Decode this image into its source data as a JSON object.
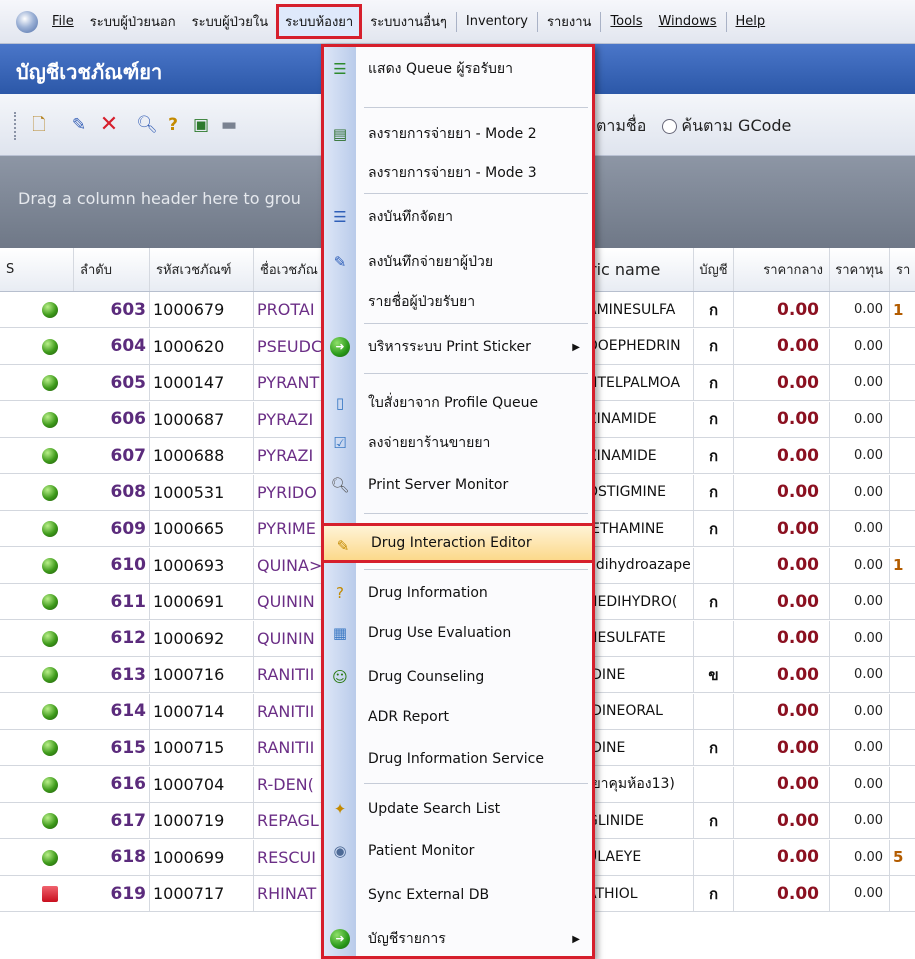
{
  "menubar": {
    "items": [
      {
        "label": "File",
        "underline": true
      },
      {
        "label": "ระบบผู้ป่วยนอก"
      },
      {
        "label": "ระบบผู้ป่วยใน"
      },
      {
        "label": "ระบบห้องยา",
        "active": true
      },
      {
        "label": "ระบบงานอื่นๆ"
      },
      {
        "label": "Inventory"
      },
      {
        "label": "รายงาน"
      },
      {
        "label": "Tools",
        "underline": true
      },
      {
        "label": "Windows",
        "underline": true
      },
      {
        "label": "Help",
        "underline": true
      }
    ]
  },
  "window": {
    "title": "บัญชีเวชภัณฑ์ยา"
  },
  "toolbar": {
    "search_option_name": "ตามชื่อ",
    "search_option_gcode": "ค้นตาม GCode"
  },
  "grid": {
    "group_hint": "Drag a column header here to grou",
    "columns": {
      "s": "S",
      "seq": "ลำดับ",
      "code": "รหัสเวชภัณฑ์",
      "name": "ชื่อเวชภัณ",
      "generic": "ric name",
      "account": "บัญชี",
      "mid_price": "ราคากลาง",
      "cost": "ราคาทุน",
      "extra": "รา"
    },
    "rows": [
      {
        "seq": "603",
        "code": "1000679",
        "name": "PROTAI",
        "generic": "AMINESULFA",
        "account": "ก",
        "mid": "0.00",
        "cost": "0.00",
        "extra": "1",
        "status": "green"
      },
      {
        "seq": "604",
        "code": "1000620",
        "name": "PSEUDC",
        "generic": "DOEPHEDRIN",
        "account": "ก",
        "mid": "0.00",
        "cost": "0.00",
        "extra": "",
        "status": "green"
      },
      {
        "seq": "605",
        "code": "1000147",
        "name": "PYRANT",
        "generic": "NTELPALMOA",
        "account": "ก",
        "mid": "0.00",
        "cost": "0.00",
        "extra": "",
        "status": "green"
      },
      {
        "seq": "606",
        "code": "1000687",
        "name": "PYRAZI",
        "generic": "ZINAMIDE",
        "account": "ก",
        "mid": "0.00",
        "cost": "0.00",
        "extra": "",
        "status": "green"
      },
      {
        "seq": "607",
        "code": "1000688",
        "name": "PYRAZI",
        "generic": "ZINAMIDE",
        "account": "ก",
        "mid": "0.00",
        "cost": "0.00",
        "extra": "",
        "status": "green"
      },
      {
        "seq": "608",
        "code": "1000531",
        "name": "PYRIDO",
        "generic": "OSTIGMINE",
        "account": "ก",
        "mid": "0.00",
        "cost": "0.00",
        "extra": "",
        "status": "green"
      },
      {
        "seq": "609",
        "code": "1000665",
        "name": "PYRIME",
        "generic": "IETHAMINE",
        "account": "ก",
        "mid": "0.00",
        "cost": "0.00",
        "extra": "",
        "status": "green"
      },
      {
        "seq": "610",
        "code": "1000693",
        "name": "QUINA>",
        "generic": "ndihydroazape",
        "account": "",
        "mid": "0.00",
        "cost": "0.00",
        "extra": "1",
        "status": "green"
      },
      {
        "seq": "611",
        "code": "1000691",
        "name": "QUININ",
        "generic": "NEDIHYDRO(",
        "account": "ก",
        "mid": "0.00",
        "cost": "0.00",
        "extra": "",
        "status": "green"
      },
      {
        "seq": "612",
        "code": "1000692",
        "name": "QUININ",
        "generic": "NESULFATE",
        "account": "",
        "mid": "0.00",
        "cost": "0.00",
        "extra": "",
        "status": "green"
      },
      {
        "seq": "613",
        "code": "1000716",
        "name": "RANITII",
        "generic": "IDINE",
        "account": "ข",
        "mid": "0.00",
        "cost": "0.00",
        "extra": "",
        "status": "green"
      },
      {
        "seq": "614",
        "code": "1000714",
        "name": "RANITII",
        "generic": "IDINEORAL",
        "account": "",
        "mid": "0.00",
        "cost": "0.00",
        "extra": "",
        "status": "green"
      },
      {
        "seq": "615",
        "code": "1000715",
        "name": "RANITII",
        "generic": "IDINE",
        "account": "ก",
        "mid": "0.00",
        "cost": "0.00",
        "extra": "",
        "status": "green"
      },
      {
        "seq": "616",
        "code": "1000704",
        "name": "R-DEN(",
        "generic": "(ยาคุมห้อง13)",
        "account": "",
        "mid": "0.00",
        "cost": "0.00",
        "extra": "",
        "status": "green"
      },
      {
        "seq": "617",
        "code": "1000719",
        "name": "REPAGL",
        "generic": "GLINIDE",
        "account": "ก",
        "mid": "0.00",
        "cost": "0.00",
        "extra": "",
        "status": "green"
      },
      {
        "seq": "618",
        "code": "1000699",
        "name": "RESCUI",
        "generic": "ULAEYE",
        "account": "",
        "mid": "0.00",
        "cost": "0.00",
        "extra": "5",
        "status": "green"
      },
      {
        "seq": "619",
        "code": "1000717",
        "name": "RHINAT",
        "generic": "ATHIOL",
        "account": "ก",
        "mid": "0.00",
        "cost": "0.00",
        "extra": "",
        "status": "red"
      }
    ]
  },
  "dropdown": {
    "items": [
      {
        "label": "แสดง Queue ผู้รอรับยา",
        "icon": "queue-list-icon"
      },
      {
        "label": "ลงรายการจ่ายยา - Mode 2",
        "icon": "form-icon"
      },
      {
        "label": "ลงรายการจ่ายยา - Mode 3"
      },
      {
        "label": "ลงบันทึกจัดยา",
        "icon": "indent-list-icon"
      },
      {
        "label": "ลงบันทึกจ่ายยาผู้ป่วย",
        "icon": "checklist-pen-icon"
      },
      {
        "label": "รายชื่อผู้ป่วยรับยา"
      },
      {
        "label": "บริหารระบบ Print Sticker",
        "icon": "green-arrow-icon",
        "submenu": true
      },
      {
        "label": "ใบสั่งยาจาก Profile Queue",
        "icon": "document-icon"
      },
      {
        "label": "ลงจ่ายยาร้านขายยา",
        "icon": "check-document-icon"
      },
      {
        "label": "Print Server Monitor",
        "icon": "magnifier-document-icon"
      },
      {
        "label": "Drug Interaction Editor",
        "icon": "edit-document-icon",
        "highlighted": true
      },
      {
        "label": "Drug Information",
        "icon": "help-icon"
      },
      {
        "label": "Drug Use Evaluation",
        "icon": "evaluation-icon"
      },
      {
        "label": "Drug Counseling",
        "icon": "smiley-icon"
      },
      {
        "label": "ADR Report"
      },
      {
        "label": "Drug Information Service"
      },
      {
        "label": "Update Search List",
        "icon": "magic-wand-icon"
      },
      {
        "label": "Patient Monitor",
        "icon": "monitor-cylinder-icon"
      },
      {
        "label": "Sync External DB"
      },
      {
        "label": "บัญชีรายการ",
        "icon": "green-arrow-icon",
        "submenu": true
      }
    ]
  },
  "colors": {
    "accent_red": "#d61f2c",
    "title_blue": "#2c58a8",
    "seq_purple": "#5b2b7c",
    "price_red": "#8b1020",
    "status_green": "#3e9a1a"
  }
}
